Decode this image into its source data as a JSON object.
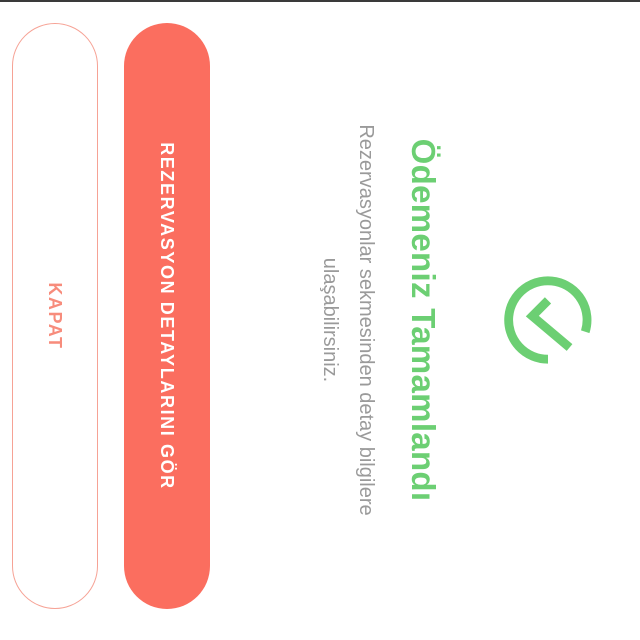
{
  "dialog": {
    "title": "Ödemeniz Tamamlandı",
    "message": "Rezervasyonlar sekmesinden detay bilgilere ulaşabilirsiniz.",
    "icon": "check-circle-icon",
    "primary_button_label": "REZERVASYON DETAYLARINI GÖR",
    "secondary_button_label": "KAPAT"
  },
  "colors": {
    "success": "#6ccf73",
    "primary_button": "#fb6e5f",
    "secondary_button_text": "#f78c7c",
    "message_text": "#9a9a9a"
  }
}
